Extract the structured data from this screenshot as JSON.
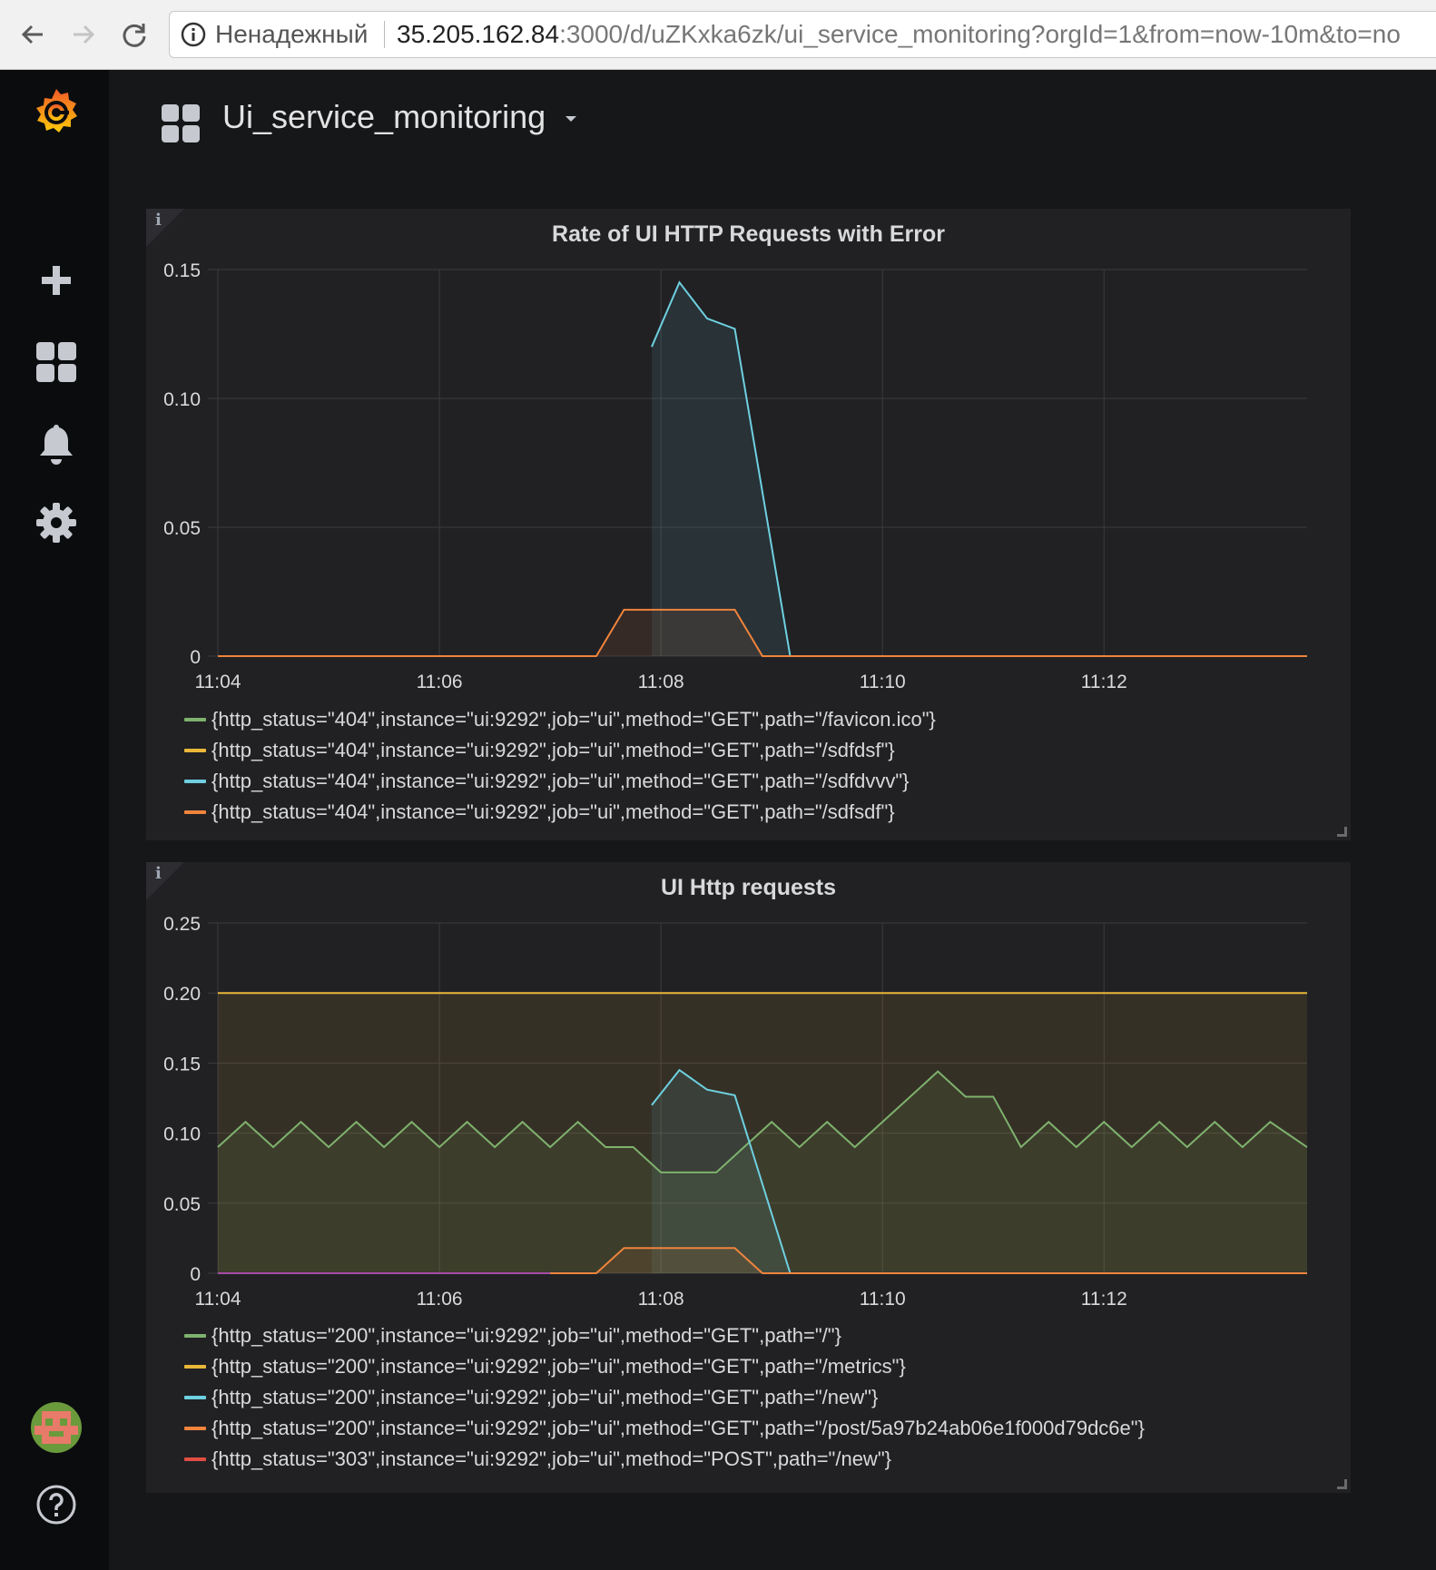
{
  "browser": {
    "insecure_label": "Ненадежный",
    "url_host": "35.205.162.84",
    "url_rest": ":3000/d/uZKxka6zk/ui_service_monitoring?orgId=1&from=now-10m&to=no"
  },
  "dashboard": {
    "title": "Ui_service_monitoring"
  },
  "panels": [
    {
      "title": "Rate of UI HTTP Requests with Error",
      "legend": [
        {
          "label": "{http_status=\"404\",instance=\"ui:9292\",job=\"ui\",method=\"GET\",path=\"/favicon.ico\"}",
          "color": "#7eb26d"
        },
        {
          "label": "{http_status=\"404\",instance=\"ui:9292\",job=\"ui\",method=\"GET\",path=\"/sdfdsf\"}",
          "color": "#eab839"
        },
        {
          "label": "{http_status=\"404\",instance=\"ui:9292\",job=\"ui\",method=\"GET\",path=\"/sdfdvvv\"}",
          "color": "#6ed0e0"
        },
        {
          "label": "{http_status=\"404\",instance=\"ui:9292\",job=\"ui\",method=\"GET\",path=\"/sdfsdf\"}",
          "color": "#ef843c"
        }
      ]
    },
    {
      "title": "UI Http requests",
      "legend": [
        {
          "label": "{http_status=\"200\",instance=\"ui:9292\",job=\"ui\",method=\"GET\",path=\"/\"}",
          "color": "#7eb26d"
        },
        {
          "label": "{http_status=\"200\",instance=\"ui:9292\",job=\"ui\",method=\"GET\",path=\"/metrics\"}",
          "color": "#eab839"
        },
        {
          "label": "{http_status=\"200\",instance=\"ui:9292\",job=\"ui\",method=\"GET\",path=\"/new\"}",
          "color": "#6ed0e0"
        },
        {
          "label": "{http_status=\"200\",instance=\"ui:9292\",job=\"ui\",method=\"GET\",path=\"/post/5a97b24ab06e1f000d79dc6e\"}",
          "color": "#ef843c"
        },
        {
          "label": "{http_status=\"303\",instance=\"ui:9292\",job=\"ui\",method=\"POST\",path=\"/new\"}",
          "color": "#e24d42"
        }
      ]
    }
  ],
  "chart_data": [
    {
      "type": "area",
      "title": "Rate of UI HTTP Requests with Error",
      "x_ticks": [
        "11:04",
        "11:06",
        "11:08",
        "11:10",
        "11:12"
      ],
      "y_ticks": [
        "0",
        "0.05",
        "0.10",
        "0.15"
      ],
      "xlim": [
        "11:04",
        "11:13:50"
      ],
      "ylim": [
        0,
        0.15
      ],
      "grid": true,
      "series": [
        {
          "name": "{http_status=\"404\",instance=\"ui:9292\",job=\"ui\",method=\"GET\",path=\"/favicon.ico\"}",
          "color": "#7eb26d",
          "x": [
            "11:04",
            "11:06",
            "11:07"
          ],
          "y": [
            0,
            0,
            0
          ]
        },
        {
          "name": "{http_status=\"404\",instance=\"ui:9292\",job=\"ui\",method=\"GET\",path=\"/sdfdvvv\"}",
          "color": "#6ed0e0",
          "x": [
            "11:07:55",
            "11:08:10",
            "11:08:25",
            "11:08:40",
            "11:09:10"
          ],
          "y": [
            0.12,
            0.145,
            0.131,
            0.127,
            0
          ]
        },
        {
          "name": "{http_status=\"404\",instance=\"ui:9292\",job=\"ui\",method=\"GET\",path=\"/sdfsdf\"}",
          "color": "#ef843c",
          "x": [
            "11:04",
            "11:07:25",
            "11:07:40",
            "11:08:25",
            "11:08:40",
            "11:08:55",
            "11:13:50"
          ],
          "y": [
            0,
            0,
            0.018,
            0.018,
            0.018,
            0,
            0
          ]
        }
      ]
    },
    {
      "type": "area",
      "title": "UI Http requests",
      "x_ticks": [
        "11:04",
        "11:06",
        "11:08",
        "11:10",
        "11:12"
      ],
      "y_ticks": [
        "0",
        "0.05",
        "0.10",
        "0.15",
        "0.20",
        "0.25"
      ],
      "xlim": [
        "11:04",
        "11:13:50"
      ],
      "ylim": [
        0,
        0.25
      ],
      "grid": true,
      "series": [
        {
          "name": "{http_status=\"200\",instance=\"ui:9292\",job=\"ui\",method=\"GET\",path=\"/\"}",
          "color": "#7eb26d",
          "x": [
            "11:04",
            "11:04:15",
            "11:04:30",
            "11:04:45",
            "11:05",
            "11:05:15",
            "11:05:30",
            "11:05:45",
            "11:06",
            "11:06:15",
            "11:06:30",
            "11:06:45",
            "11:07",
            "11:07:15",
            "11:07:30",
            "11:07:45",
            "11:08",
            "11:08:15",
            "11:08:30",
            "11:08:45",
            "11:09",
            "11:09:15",
            "11:09:30",
            "11:09:45",
            "11:10",
            "11:10:15",
            "11:10:30",
            "11:10:45",
            "11:11",
            "11:11:15",
            "11:11:30",
            "11:11:45",
            "11:12",
            "11:12:15",
            "11:12:30",
            "11:12:45",
            "11:13",
            "11:13:15",
            "11:13:30",
            "11:13:50"
          ],
          "y": [
            0.09,
            0.108,
            0.09,
            0.108,
            0.09,
            0.108,
            0.09,
            0.108,
            0.09,
            0.108,
            0.09,
            0.108,
            0.09,
            0.108,
            0.09,
            0.09,
            0.072,
            0.072,
            0.072,
            0.09,
            0.108,
            0.09,
            0.108,
            0.09,
            0.108,
            0.126,
            0.144,
            0.126,
            0.126,
            0.09,
            0.108,
            0.09,
            0.108,
            0.09,
            0.108,
            0.09,
            0.108,
            0.09,
            0.108,
            0.09
          ]
        },
        {
          "name": "{http_status=\"200\",instance=\"ui:9292\",job=\"ui\",method=\"GET\",path=\"/metrics\"}",
          "color": "#eab839",
          "x": [
            "11:04",
            "11:13:50"
          ],
          "y": [
            0.2,
            0.2
          ]
        },
        {
          "name": "{http_status=\"200\",instance=\"ui:9292\",job=\"ui\",method=\"GET\",path=\"/new\"}",
          "color": "#6ed0e0",
          "x": [
            "11:07:55",
            "11:08:10",
            "11:08:25",
            "11:08:40",
            "11:09:10"
          ],
          "y": [
            0.12,
            0.145,
            0.131,
            0.127,
            0
          ]
        },
        {
          "name": "{http_status=\"200\",instance=\"ui:9292\",job=\"ui\",method=\"GET\",path=\"/post/5a97b24ab06e1f000d79dc6e\"}",
          "color": "#ef843c",
          "x": [
            "11:04",
            "11:07:25",
            "11:07:40",
            "11:08:25",
            "11:08:40",
            "11:08:55",
            "11:13:50"
          ],
          "y": [
            0,
            0,
            0.018,
            0.018,
            0.018,
            0,
            0
          ]
        },
        {
          "name": "{http_status=\"303\",instance=\"ui:9292\",job=\"ui\",method=\"POST\",path=\"/new\"}",
          "color": "#a64ca6",
          "x": [
            "11:04",
            "11:07"
          ],
          "y": [
            0,
            0
          ]
        }
      ]
    }
  ]
}
